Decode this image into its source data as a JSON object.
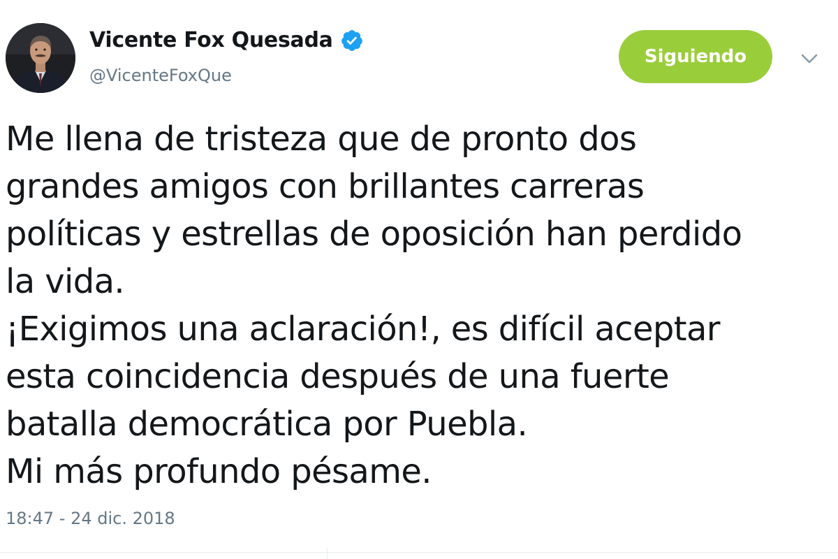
{
  "user": {
    "display_name": "Vicente Fox Quesada",
    "handle": "@VicenteFoxQue",
    "verified": true,
    "avatar_icon": "profile-photo"
  },
  "actions": {
    "follow_label": "Siguiendo",
    "menu_icon": "chevron-down-icon"
  },
  "tweet": {
    "lines": [
      "Me llena de tristeza que de pronto dos",
      "grandes amigos con brillantes carreras",
      "políticas y estrellas de oposición han perdido",
      "la vida.",
      "¡Exigimos una aclaración!, es difícil aceptar",
      "esta coincidencia después de una fuerte",
      "batalla democrática por Puebla.",
      "Mi más profundo pésame."
    ],
    "timestamp": "18:47 - 24 dic. 2018"
  },
  "colors": {
    "follow_button": "#9acd3a",
    "verified_badge": "#1da1f2",
    "secondary_text": "#657786",
    "primary_text": "#14171a"
  }
}
